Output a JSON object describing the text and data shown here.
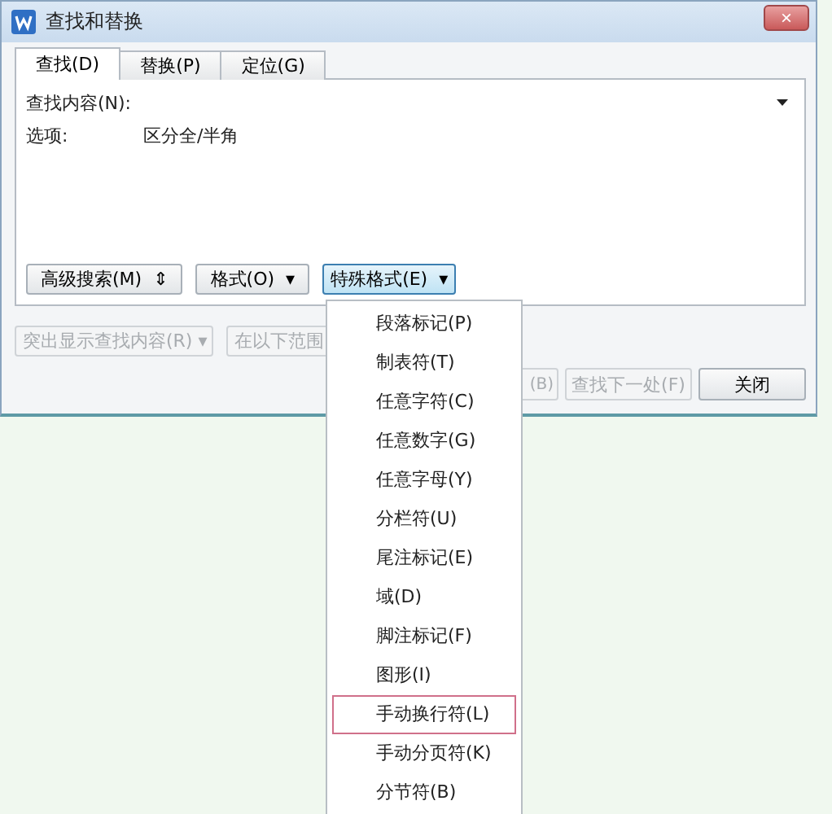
{
  "window": {
    "title": "查找和替换",
    "close": "×"
  },
  "tabs": [
    {
      "label": "查找(D)",
      "selected": true
    },
    {
      "label": "替换(P)",
      "selected": false
    },
    {
      "label": "定位(G)",
      "selected": false
    }
  ],
  "find_field": {
    "label": "查找内容(N):"
  },
  "options": {
    "label": "选项:",
    "value": "区分全/半角"
  },
  "format_buttons": [
    {
      "label": "高级搜索(M)",
      "arrow": "⇕",
      "pressed": false
    },
    {
      "label": "格式(O)",
      "arrow": "▾",
      "pressed": false
    },
    {
      "label": "特殊格式(E)",
      "arrow": "▾",
      "pressed": true
    }
  ],
  "disabled_row": [
    {
      "label": "突出显示查找内容(R)",
      "arrow": "▾"
    },
    {
      "label": "在以下范围"
    }
  ],
  "action_buttons": [
    {
      "label": "(B)",
      "disabled": true
    },
    {
      "label": "查找下一处(F)",
      "disabled": true
    },
    {
      "label": "关闭",
      "disabled": false
    }
  ],
  "special_menu": [
    {
      "label": "段落标记(P)",
      "selected": false
    },
    {
      "label": "制表符(T)",
      "selected": false
    },
    {
      "label": "任意字符(C)",
      "selected": false
    },
    {
      "label": "任意数字(G)",
      "selected": false
    },
    {
      "label": "任意字母(Y)",
      "selected": false
    },
    {
      "label": "分栏符(U)",
      "selected": false
    },
    {
      "label": "尾注标记(E)",
      "selected": false
    },
    {
      "label": "域(D)",
      "selected": false
    },
    {
      "label": "脚注标记(F)",
      "selected": false
    },
    {
      "label": "图形(I)",
      "selected": false
    },
    {
      "label": "手动换行符(L)",
      "selected": true
    },
    {
      "label": "手动分页符(K)",
      "selected": false
    },
    {
      "label": "分节符(B)",
      "selected": false
    }
  ]
}
